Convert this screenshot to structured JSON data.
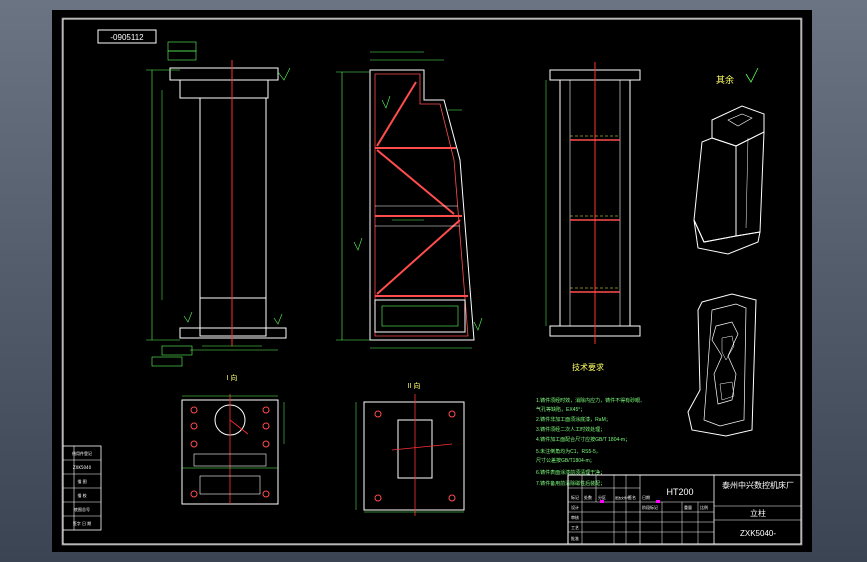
{
  "drawing": {
    "code_tag": "-0905112",
    "section_label_left": "I 向",
    "section_label_right": "II 向",
    "roughness_note": "其余",
    "tech_title": "技术要求",
    "tech_notes": [
      "1.铸件须经时效，消除内应力，铸件不得有砂眼、",
      "  气孔等缺陷，EX45°；",
      "2.铸件非加工面须涂底漆，RaM；",
      "3.铸件须经二次人工时效处理；",
      "4.铸件加工面配合尺寸应按GB/T 1804-m；",
      "5.未注倒角均为C1，RS5-5，",
      "  尺寸公差按GB/T1804-m；",
      "6.铸件表面涂漆前须清理干净；",
      "7.铸件备用前清除磁性后装配；"
    ]
  },
  "title_block": {
    "material": "HT200",
    "company": "泰州中兴数控机床厂",
    "part_name": "立柱",
    "drawing_no": "ZXK5040-",
    "row_labels": [
      "标记",
      "处数",
      "分区",
      "更改文件号",
      "签名",
      "日期"
    ],
    "design_labels": [
      "设计",
      "审核",
      "工艺",
      "批准"
    ],
    "scale_labels": [
      "阶段标记",
      "重量",
      "比例"
    ]
  },
  "left_strip": {
    "labels": [
      "借用件登记",
      "ZXK5040",
      "描 图",
      "描 校",
      "底图总号",
      "签字  日 期"
    ]
  },
  "colors": {
    "line": "#ffffff",
    "center": "#ff3030",
    "section": "#ff4d4d",
    "dim": "#5cff5c",
    "hidden": "#ffff40",
    "text_yellow": "#ffff66",
    "text_green": "#7cff7c",
    "highlight": "#ff00ff"
  }
}
